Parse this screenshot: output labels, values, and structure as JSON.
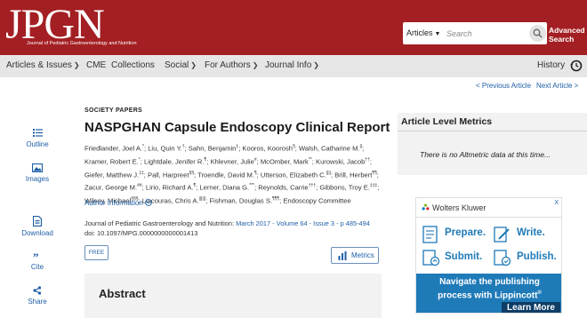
{
  "header": {
    "logo_text": "JPGN",
    "logo_subtitle": "Journal of Pediatric Gastroenterology and Nutrition",
    "search": {
      "type_label": "Articles",
      "placeholder": "Search"
    },
    "advanced_search_line1": "Advanced",
    "advanced_search_line2": "Search"
  },
  "nav": {
    "items": [
      {
        "label": "Articles & Issues",
        "has_menu": true
      },
      {
        "label": "CME",
        "has_menu": false
      },
      {
        "label": "Collections",
        "has_menu": false
      },
      {
        "label": "Social",
        "has_menu": true
      },
      {
        "label": "For Authors",
        "has_menu": true
      },
      {
        "label": "Journal Info",
        "has_menu": true
      }
    ],
    "history_label": "History"
  },
  "article_nav": {
    "prev": "< Previous Article",
    "next": "Next Article >"
  },
  "sidebar": {
    "outline": "Outline",
    "images": "Images",
    "download": "Download",
    "cite": "Cite",
    "share": "Share"
  },
  "article": {
    "section": "SOCIETY PAPERS",
    "title": "NASPGHAN Capsule Endoscopy Clinical Report",
    "authors": [
      {
        "name": "Friedlander, Joel A.",
        "sup": "*"
      },
      {
        "name": "Liu, Quin Y.",
        "sup": "†"
      },
      {
        "name": "Sahn, Benjamin",
        "sup": "‡"
      },
      {
        "name": "Kooros, Koorosh",
        "sup": "§"
      },
      {
        "name": "Walsh, Catharine M.",
        "sup": "||"
      },
      {
        "name": "Kramer, Robert E.",
        "sup": "*"
      },
      {
        "name": "Lightdale, Jenifer R.",
        "sup": "¶"
      },
      {
        "name": "Khlevner, Julie",
        "sup": "#"
      },
      {
        "name": "McOmber, Mark",
        "sup": "**"
      },
      {
        "name": "Kurowski, Jacob",
        "sup": "††"
      },
      {
        "name": "Giefer, Matthew J.",
        "sup": "‡‡"
      },
      {
        "name": "Pall, Harpreet",
        "sup": "§§"
      },
      {
        "name": "Troendle, David M.",
        "sup": "¶"
      },
      {
        "name": "Utterson, Elizabeth C.",
        "sup": "||||"
      },
      {
        "name": "Brill, Herbert",
        "sup": "¶¶"
      },
      {
        "name": "Zacur, George M.",
        "sup": "##"
      },
      {
        "name": "Lirio, Richard A.",
        "sup": "¶"
      },
      {
        "name": "Lerner, Diana G.",
        "sup": "***"
      },
      {
        "name": "Reynolds, Carrie",
        "sup": "†††"
      },
      {
        "name": "Gibbons, Troy E.",
        "sup": "‡‡‡"
      },
      {
        "name": "Wilsey, Michael",
        "sup": "§§§"
      },
      {
        "name": "Liacouras, Chris A.",
        "sup": "||||||"
      },
      {
        "name": "Fishman, Douglas S.",
        "sup": "¶¶¶"
      },
      {
        "name": "Endoscopy Committee",
        "sup": ""
      }
    ],
    "author_info": "Author Information",
    "journal_prefix": "Journal of Pediatric Gastroenterology and Nutrition:",
    "journal_link": "March 2017 - Volume 64 - Issue 3 - p 485-494",
    "doi": "doi: 10.1097/MPG.0000000000001413",
    "free_label": "FREE",
    "metrics_label": "Metrics",
    "abstract_title": "Abstract"
  },
  "metrics_panel": {
    "heading": "Article Level Metrics",
    "message": "There is no Altmetric data at this time..."
  },
  "ad": {
    "brand": "Wolters Kluwer",
    "steps": [
      "Prepare.",
      "Write.",
      "Submit.",
      "Publish."
    ],
    "banner_text_1": "Navigate the publishing",
    "banner_text_2": "process with Lippincott",
    "cta": "Learn More",
    "close": "X",
    "colors": {
      "accent": "#1f7ab8",
      "dark": "#0e3d66"
    }
  },
  "colors": {
    "header": "#a31f23",
    "nav": "#e6e6e6",
    "link": "#1f5fa6"
  }
}
